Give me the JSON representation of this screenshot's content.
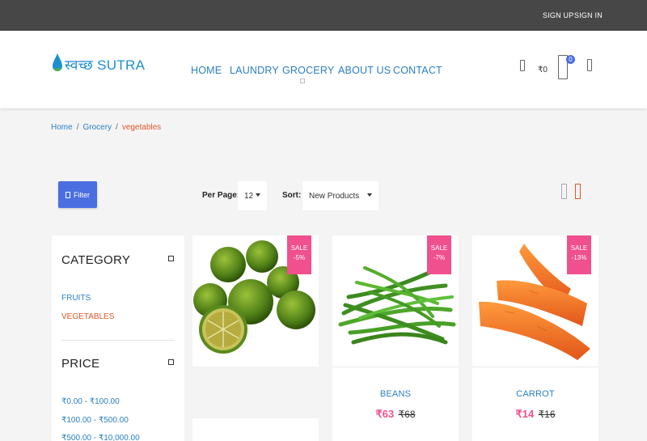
{
  "topbar": {
    "signup": "SIGN UP",
    "signin": "SIGN IN"
  },
  "logo": {
    "text": "स्वच्छ SUTRA"
  },
  "nav": {
    "home": "HOME",
    "laundry": "LAUNDRY",
    "grocery": "GROCERY",
    "about": "ABOUT US",
    "contact": "CONTACT"
  },
  "header": {
    "cart_total": "₹0",
    "cart_count": "0"
  },
  "breadcrumb": {
    "home": "Home",
    "grocery": "Grocery",
    "current": "vegetables",
    "sep": "/"
  },
  "toolbar": {
    "filter_label": "Filter",
    "per_page_label": "Per Page:",
    "per_page_value": "12",
    "sort_label": "Sort:",
    "sort_value": "New Products"
  },
  "sidebar": {
    "category_title": "CATEGORY",
    "categories": [
      "FRUITS",
      "VEGETABLES"
    ],
    "price_title": "PRICE",
    "price_ranges": [
      "₹0.00 - ₹100.00",
      "₹100.00 - ₹500.00",
      "₹500.00 - ₹10,000.00"
    ]
  },
  "products": [
    {
      "name": "",
      "sale": "SALE",
      "discount": "-5%",
      "price": "",
      "old_price": ""
    },
    {
      "name": "BEANS",
      "sale": "SALE",
      "discount": "-7%",
      "price": "₹63",
      "old_price": "₹68"
    },
    {
      "name": "CARROT",
      "sale": "SALE",
      "discount": "-13%",
      "price": "₹14",
      "old_price": "₹16"
    }
  ],
  "colors": {
    "accent": "#4b6ee0",
    "link": "#2a7fc4",
    "active": "#e0572b",
    "sale": "#f0508e",
    "topbar": "#474747"
  }
}
